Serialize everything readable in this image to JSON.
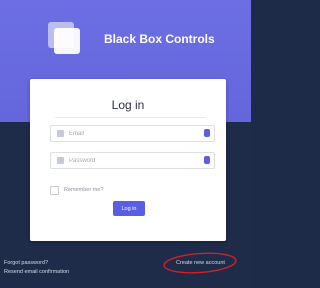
{
  "brand": {
    "name": "Black Box Controls",
    "logo_icon": "stacked-squares-logo"
  },
  "form": {
    "title": "Log in",
    "email_placeholder": "Email",
    "password_placeholder": "Password",
    "email_icon": "envelope-icon",
    "password_icon": "lock-icon",
    "autofill_icon": "key-icon",
    "remember_label": "Remember me?",
    "login_label": "Log in"
  },
  "footer": {
    "forgot_password": "Forgot password?",
    "resend_confirmation": "Resend email confirmation",
    "create_account": "Create new account"
  },
  "colors": {
    "primary": "#5a5ee4",
    "header_bg": "#6466dc",
    "page_bg": "#1e2c4a",
    "annotation": "#d0202a"
  }
}
